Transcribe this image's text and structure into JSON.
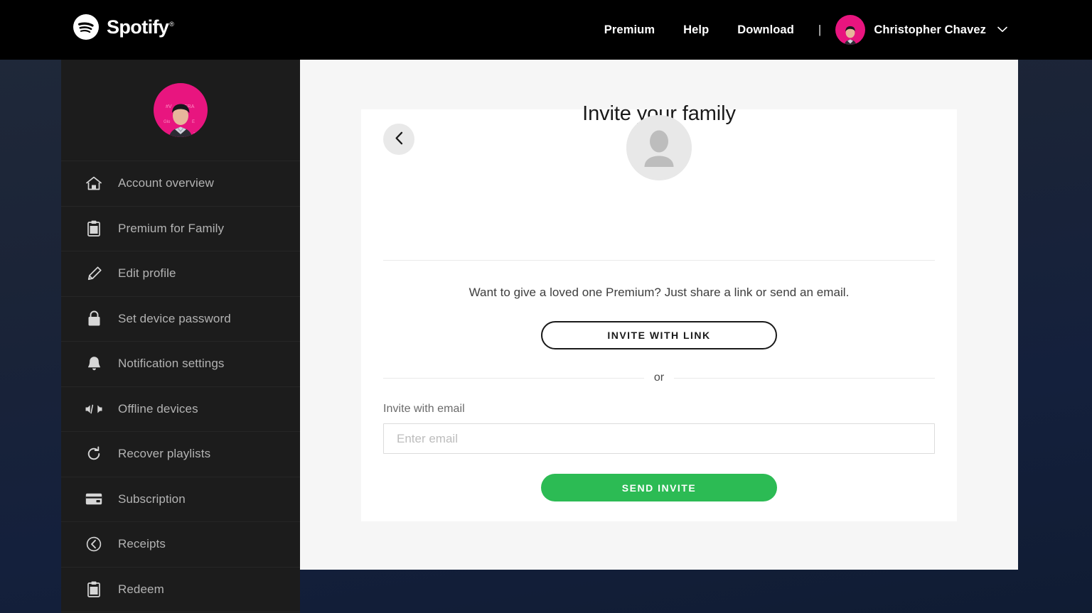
{
  "header": {
    "brand": "Spotify",
    "brand_reg": "®",
    "brand_icon": "spotify-logo-icon",
    "nav": [
      {
        "label": "Premium"
      },
      {
        "label": "Help"
      },
      {
        "label": "Download"
      }
    ],
    "separator": "|",
    "user": {
      "name": "Christopher Chavez",
      "avatar_alt": "user-avatar",
      "chevron_icon": "chevron-down-icon"
    }
  },
  "sidebar": {
    "avatar_alt": "profile-avatar",
    "items": [
      {
        "label": "Account overview",
        "icon": "home-icon"
      },
      {
        "label": "Premium for Family",
        "icon": "clipboard-icon"
      },
      {
        "label": "Edit profile",
        "icon": "pencil-icon"
      },
      {
        "label": "Set device password",
        "icon": "lock-icon"
      },
      {
        "label": "Notification settings",
        "icon": "bell-icon"
      },
      {
        "label": "Offline devices",
        "icon": "devices-icon"
      },
      {
        "label": "Recover playlists",
        "icon": "refresh-icon"
      },
      {
        "label": "Subscription",
        "icon": "credit-card-icon"
      },
      {
        "label": "Receipts",
        "icon": "clock-back-icon"
      },
      {
        "label": "Redeem",
        "icon": "clipboard-icon"
      }
    ]
  },
  "main": {
    "back_icon": "chevron-left-icon",
    "placeholder_icon": "person-placeholder-icon",
    "title": "Invite your family",
    "lede": "Want to give a loved one Premium? Just share a link or send an email.",
    "invite_link_button": "INVITE WITH LINK",
    "or_text": "or",
    "email_label": "Invite with email",
    "email_placeholder": "Enter email",
    "email_value": "",
    "send_button": "SEND INVITE"
  },
  "colors": {
    "brand_green": "#2cbb54",
    "header_bg": "#000000",
    "sidebar_bg": "#1c1c1c",
    "content_bg": "#f6f6f6",
    "card_bg": "#ffffff",
    "sidebar_text": "#b3b3b3"
  }
}
